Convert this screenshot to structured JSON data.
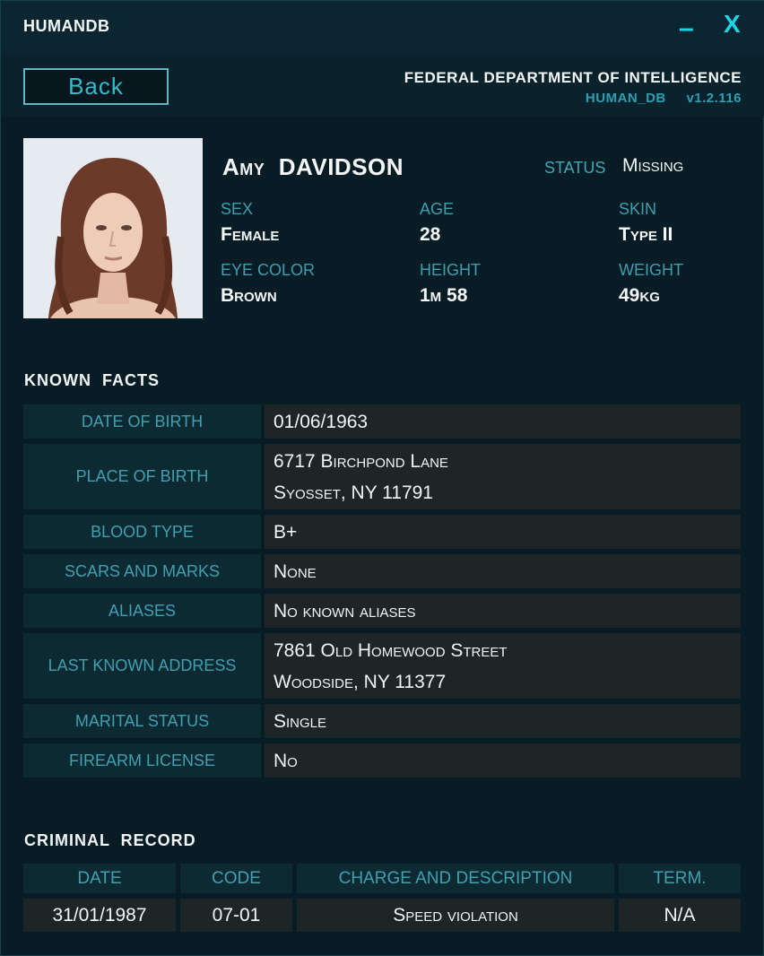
{
  "app": {
    "title": "HUMANDB",
    "minimize_label": "–",
    "close_label": "X"
  },
  "header": {
    "back_label": "Back",
    "agency": "FEDERAL DEPARTMENT OF INTELLIGENCE",
    "db_name": "HUMAN_DB",
    "version": "v1.2.116"
  },
  "profile": {
    "first_name": "Amy",
    "last_name": "DAVIDSON",
    "status_label": "STATUS",
    "status_value": "Missing",
    "attributes": [
      {
        "label": "SEX",
        "value": "Female"
      },
      {
        "label": "AGE",
        "value": "28"
      },
      {
        "label": "SKIN",
        "value": "Type II"
      },
      {
        "label": "EYE COLOR",
        "value": "Brown"
      },
      {
        "label": "HEIGHT",
        "value": "1m 58"
      },
      {
        "label": "WEIGHT",
        "value": "49kg"
      }
    ]
  },
  "known_facts": {
    "title": "KNOWN FACTS",
    "rows": [
      {
        "label": "DATE OF BIRTH",
        "lines": [
          "01/06/1963"
        ]
      },
      {
        "label": "PLACE OF BIRTH",
        "lines": [
          "6717 Birchpond Lane",
          "Syosset, NY 11791"
        ]
      },
      {
        "label": "BLOOD TYPE",
        "lines": [
          "B+"
        ]
      },
      {
        "label": "SCARS AND MARKS",
        "lines": [
          "None"
        ]
      },
      {
        "label": "ALIASES",
        "lines": [
          "No known aliases"
        ]
      },
      {
        "label": "LAST KNOWN ADDRESS",
        "lines": [
          "7861 Old Homewood Street",
          "Woodside, NY 11377"
        ]
      },
      {
        "label": "MARITAL STATUS",
        "lines": [
          "Single"
        ]
      },
      {
        "label": "FIREARM LICENSE",
        "lines": [
          "No"
        ]
      }
    ]
  },
  "criminal_record": {
    "title": "CRIMINAL RECORD",
    "columns": [
      "DATE",
      "CODE",
      "CHARGE AND DESCRIPTION",
      "TERM."
    ],
    "rows": [
      [
        "31/01/1987",
        "07-01",
        "Speed violation",
        "N/A"
      ]
    ]
  },
  "colors": {
    "accent": "#18d6e8",
    "label": "#3fa0b0",
    "background": "#081c25",
    "label_cell": "#0d2a33",
    "value_cell": "#1d2527"
  }
}
